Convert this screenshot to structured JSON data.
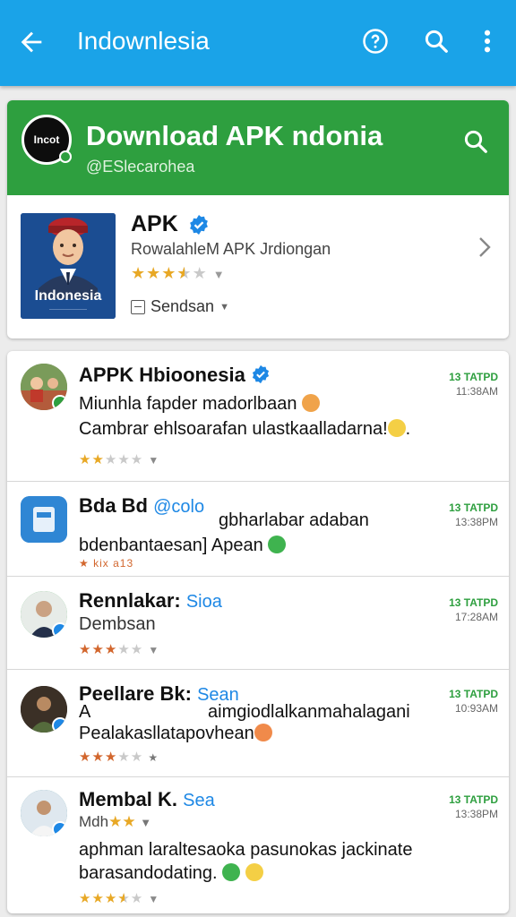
{
  "appbar": {
    "title": "Indownlesia",
    "icons": [
      "back-arrow-icon",
      "help-icon",
      "search-icon",
      "more-vert-icon"
    ]
  },
  "featured": {
    "banner_title": "Download APK ndonia",
    "banner_subtitle": "@ESlecarohea",
    "logo_text": "Incot",
    "thumb_label": "Indonesia",
    "thumb_sublabel": "——————",
    "app_title": "APK",
    "app_subtitle": "RowalahleM APK Jrdiongan",
    "rating_stars": 3.5,
    "dropdown_value": "Sendsan"
  },
  "list": [
    {
      "name": "APPK Hbioonesia",
      "tag": "",
      "verified": true,
      "time_top": "13 TATPD",
      "time_bottom": "11:38AM",
      "line1": "Miunhla fapder madorlbaan",
      "line2": "Cambrar ehlsoarafan ulastkaalladarna!",
      "stars": 2.5
    },
    {
      "name": "Bda Bd",
      "tag": "@colo",
      "verified": false,
      "time_top": "13 TATPD",
      "time_bottom": "13:38PM",
      "line1": "gbharlabar adaban",
      "line2": "bdenbantaesan] Apean",
      "stars_text": "★ kix a13"
    },
    {
      "name": "Rennlakar:",
      "tag": "Sioa",
      "verified": false,
      "time_top": "13 TATPD",
      "time_bottom": "17:28AM",
      "line1": "Dembsan",
      "line2": "",
      "stars": 3
    },
    {
      "name": "Peellare Bk:",
      "tag": "Sean",
      "verified": false,
      "time_top": "13 TATPD",
      "time_bottom": "10:93AM",
      "line1": "A",
      "line1b": "aimgiodlalkanmahalagani",
      "line2": "Pealakasllatapovhean",
      "stars": 3
    },
    {
      "name": "Membal K.",
      "tag": "Sea",
      "verified": false,
      "time_top": "13 TATPD",
      "time_bottom": "13:38PM",
      "line1": "Mdh",
      "line2": "aphman laraltesaoka pasunokas jackinate",
      "line3": "barasandodating.",
      "stars": 3.5
    }
  ],
  "colors": {
    "appbar": "#1aa3e8",
    "banner": "#2e9f3f",
    "star": "#e8a825",
    "time_green": "#2e9f3f",
    "link_blue": "#1e88e5"
  }
}
